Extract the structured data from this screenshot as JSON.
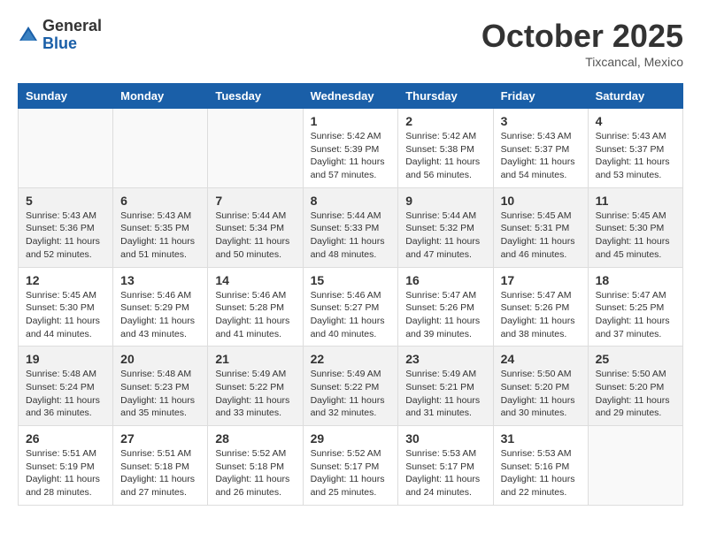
{
  "header": {
    "logo_general": "General",
    "logo_blue": "Blue",
    "month_title": "October 2025",
    "location": "Tixcancal, Mexico"
  },
  "weekdays": [
    "Sunday",
    "Monday",
    "Tuesday",
    "Wednesday",
    "Thursday",
    "Friday",
    "Saturday"
  ],
  "weeks": [
    [
      {
        "day": "",
        "info": ""
      },
      {
        "day": "",
        "info": ""
      },
      {
        "day": "",
        "info": ""
      },
      {
        "day": "1",
        "info": "Sunrise: 5:42 AM\nSunset: 5:39 PM\nDaylight: 11 hours\nand 57 minutes."
      },
      {
        "day": "2",
        "info": "Sunrise: 5:42 AM\nSunset: 5:38 PM\nDaylight: 11 hours\nand 56 minutes."
      },
      {
        "day": "3",
        "info": "Sunrise: 5:43 AM\nSunset: 5:37 PM\nDaylight: 11 hours\nand 54 minutes."
      },
      {
        "day": "4",
        "info": "Sunrise: 5:43 AM\nSunset: 5:37 PM\nDaylight: 11 hours\nand 53 minutes."
      }
    ],
    [
      {
        "day": "5",
        "info": "Sunrise: 5:43 AM\nSunset: 5:36 PM\nDaylight: 11 hours\nand 52 minutes."
      },
      {
        "day": "6",
        "info": "Sunrise: 5:43 AM\nSunset: 5:35 PM\nDaylight: 11 hours\nand 51 minutes."
      },
      {
        "day": "7",
        "info": "Sunrise: 5:44 AM\nSunset: 5:34 PM\nDaylight: 11 hours\nand 50 minutes."
      },
      {
        "day": "8",
        "info": "Sunrise: 5:44 AM\nSunset: 5:33 PM\nDaylight: 11 hours\nand 48 minutes."
      },
      {
        "day": "9",
        "info": "Sunrise: 5:44 AM\nSunset: 5:32 PM\nDaylight: 11 hours\nand 47 minutes."
      },
      {
        "day": "10",
        "info": "Sunrise: 5:45 AM\nSunset: 5:31 PM\nDaylight: 11 hours\nand 46 minutes."
      },
      {
        "day": "11",
        "info": "Sunrise: 5:45 AM\nSunset: 5:30 PM\nDaylight: 11 hours\nand 45 minutes."
      }
    ],
    [
      {
        "day": "12",
        "info": "Sunrise: 5:45 AM\nSunset: 5:30 PM\nDaylight: 11 hours\nand 44 minutes."
      },
      {
        "day": "13",
        "info": "Sunrise: 5:46 AM\nSunset: 5:29 PM\nDaylight: 11 hours\nand 43 minutes."
      },
      {
        "day": "14",
        "info": "Sunrise: 5:46 AM\nSunset: 5:28 PM\nDaylight: 11 hours\nand 41 minutes."
      },
      {
        "day": "15",
        "info": "Sunrise: 5:46 AM\nSunset: 5:27 PM\nDaylight: 11 hours\nand 40 minutes."
      },
      {
        "day": "16",
        "info": "Sunrise: 5:47 AM\nSunset: 5:26 PM\nDaylight: 11 hours\nand 39 minutes."
      },
      {
        "day": "17",
        "info": "Sunrise: 5:47 AM\nSunset: 5:26 PM\nDaylight: 11 hours\nand 38 minutes."
      },
      {
        "day": "18",
        "info": "Sunrise: 5:47 AM\nSunset: 5:25 PM\nDaylight: 11 hours\nand 37 minutes."
      }
    ],
    [
      {
        "day": "19",
        "info": "Sunrise: 5:48 AM\nSunset: 5:24 PM\nDaylight: 11 hours\nand 36 minutes."
      },
      {
        "day": "20",
        "info": "Sunrise: 5:48 AM\nSunset: 5:23 PM\nDaylight: 11 hours\nand 35 minutes."
      },
      {
        "day": "21",
        "info": "Sunrise: 5:49 AM\nSunset: 5:22 PM\nDaylight: 11 hours\nand 33 minutes."
      },
      {
        "day": "22",
        "info": "Sunrise: 5:49 AM\nSunset: 5:22 PM\nDaylight: 11 hours\nand 32 minutes."
      },
      {
        "day": "23",
        "info": "Sunrise: 5:49 AM\nSunset: 5:21 PM\nDaylight: 11 hours\nand 31 minutes."
      },
      {
        "day": "24",
        "info": "Sunrise: 5:50 AM\nSunset: 5:20 PM\nDaylight: 11 hours\nand 30 minutes."
      },
      {
        "day": "25",
        "info": "Sunrise: 5:50 AM\nSunset: 5:20 PM\nDaylight: 11 hours\nand 29 minutes."
      }
    ],
    [
      {
        "day": "26",
        "info": "Sunrise: 5:51 AM\nSunset: 5:19 PM\nDaylight: 11 hours\nand 28 minutes."
      },
      {
        "day": "27",
        "info": "Sunrise: 5:51 AM\nSunset: 5:18 PM\nDaylight: 11 hours\nand 27 minutes."
      },
      {
        "day": "28",
        "info": "Sunrise: 5:52 AM\nSunset: 5:18 PM\nDaylight: 11 hours\nand 26 minutes."
      },
      {
        "day": "29",
        "info": "Sunrise: 5:52 AM\nSunset: 5:17 PM\nDaylight: 11 hours\nand 25 minutes."
      },
      {
        "day": "30",
        "info": "Sunrise: 5:53 AM\nSunset: 5:17 PM\nDaylight: 11 hours\nand 24 minutes."
      },
      {
        "day": "31",
        "info": "Sunrise: 5:53 AM\nSunset: 5:16 PM\nDaylight: 11 hours\nand 22 minutes."
      },
      {
        "day": "",
        "info": ""
      }
    ]
  ]
}
